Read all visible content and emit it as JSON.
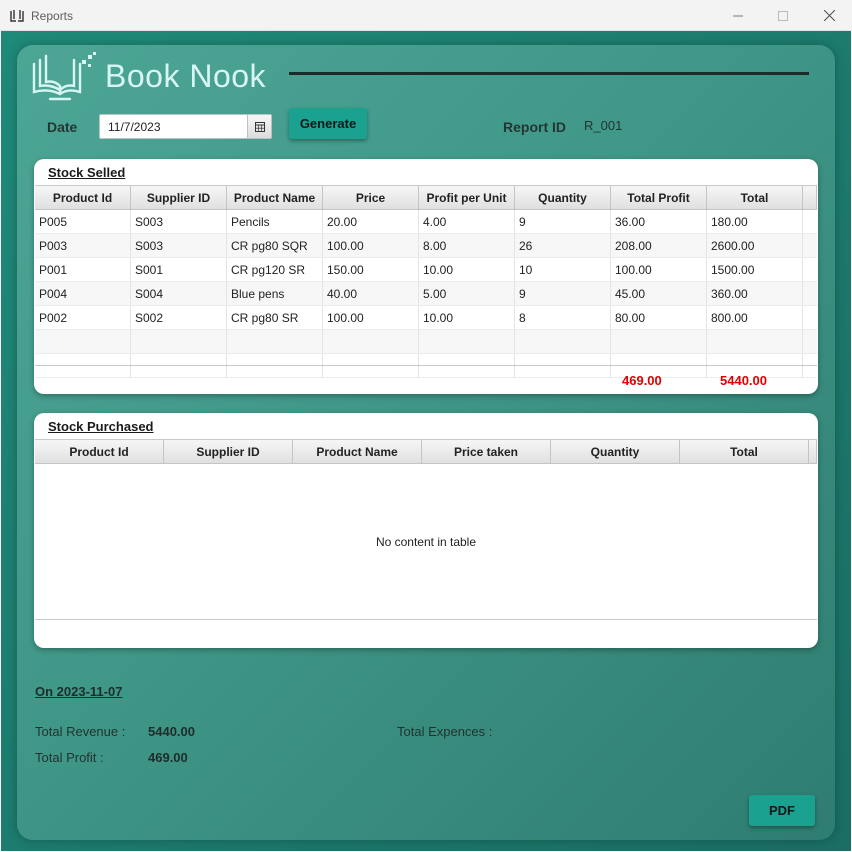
{
  "window": {
    "title": "Reports"
  },
  "brand": {
    "name": "Book Nook"
  },
  "form": {
    "date_label": "Date",
    "date_value": "11/7/2023",
    "generate_label": "Generate",
    "report_id_label": "Report ID",
    "report_id_value": "R_001"
  },
  "stock_selled": {
    "title": "Stock Selled",
    "columns": [
      "Product Id",
      "Supplier ID",
      "Product Name",
      "Price",
      "Profit per Unit",
      "Quantity",
      "Total Profit",
      "Total"
    ],
    "rows": [
      [
        "P005",
        "S003",
        "Pencils",
        "20.00",
        "4.00",
        "9",
        "36.00",
        "180.00"
      ],
      [
        "P003",
        "S003",
        "CR pg80 SQR",
        "100.00",
        "8.00",
        "26",
        "208.00",
        "2600.00"
      ],
      [
        "P001",
        "S001",
        "CR pg120 SR",
        "150.00",
        "10.00",
        "10",
        "100.00",
        "1500.00"
      ],
      [
        "P004",
        "S004",
        "Blue pens",
        "40.00",
        "5.00",
        "9",
        "45.00",
        "360.00"
      ],
      [
        "P002",
        "S002",
        "CR pg80 SR",
        "100.00",
        "10.00",
        "8",
        "80.00",
        "800.00"
      ]
    ],
    "total_profit": "469.00",
    "total": "5440.00"
  },
  "stock_purchased": {
    "title": "Stock Purchased",
    "columns": [
      "Product Id",
      "Supplier ID",
      "Product Name",
      "Price taken",
      "Quantity",
      "Total"
    ],
    "empty_message": "No content in table"
  },
  "summary": {
    "on_date": "On 2023-11-07",
    "revenue_label": "Total Revenue  :",
    "revenue_value": "5440.00",
    "expences_label": "Total Expences  :",
    "profit_label": "Total Profit     :",
    "profit_value": "469.00"
  },
  "actions": {
    "pdf_label": "PDF"
  },
  "colors": {
    "accent": "#1ba190",
    "highlight": "#e00000"
  }
}
